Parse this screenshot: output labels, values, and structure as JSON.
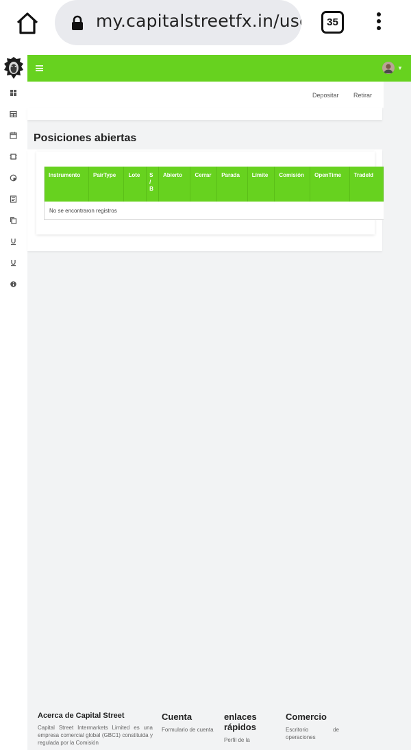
{
  "browser": {
    "url": "my.capitalstreetfx.in/use",
    "tab_count": "35",
    "icons": [
      "home-icon",
      "lock-icon",
      "tabs-icon",
      "more-vert-icon"
    ]
  },
  "header": {
    "menu_icon": "hamburger-icon",
    "avatar_icon": "user-avatar-icon",
    "accent_color": "#67d21f"
  },
  "sidebar": {
    "items": [
      {
        "icon": "dashboard-icon"
      },
      {
        "icon": "table-icon"
      },
      {
        "icon": "calendar-icon"
      },
      {
        "icon": "frame-icon"
      },
      {
        "icon": "chart-pie-icon"
      },
      {
        "icon": "document-icon"
      },
      {
        "icon": "copy-icon"
      },
      {
        "icon": "underline-icon"
      },
      {
        "icon": "underline-icon"
      },
      {
        "icon": "info-icon"
      }
    ]
  },
  "actions": {
    "deposit": "Depositar",
    "withdraw": "Retirar"
  },
  "page": {
    "title": "Posiciones abiertas"
  },
  "table": {
    "columns": [
      "Instrumento",
      "PairType",
      "Lote",
      "S / B",
      "Abierto",
      "Cerrar",
      "Parada",
      "Límite",
      "Comisión",
      "OpenTime",
      "TradeId"
    ],
    "empty_message": "No se encontraron registros"
  },
  "footer": {
    "about_title": "Acerca de Capital Street",
    "about_text": "Capital Street Intermarkets Limited es una empresa comercial global (GBC1) constituida y regulada por la Comisión",
    "account_title": "Cuenta",
    "account_text": "Formulario de cuenta",
    "links_title": "enlaces rápidos",
    "links_text": "Perfil de la",
    "trade_title": "Comercio",
    "trade_text": "Escritorio de operaciones"
  }
}
